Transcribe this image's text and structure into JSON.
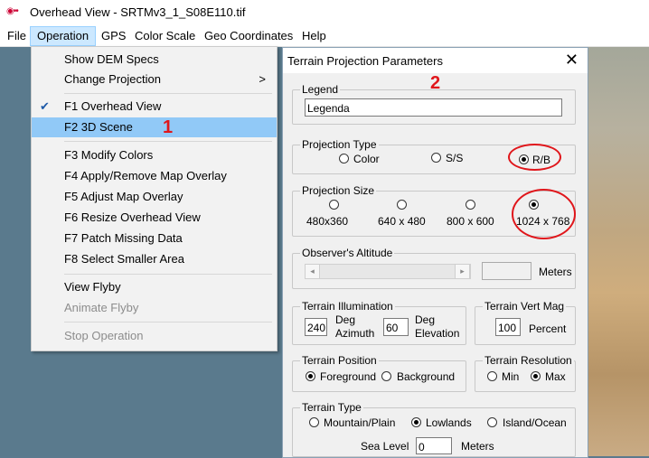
{
  "window": {
    "title": "Overhead View - SRTMv3_1_S08E110.tif",
    "icon": "app-icon"
  },
  "menubar": [
    "File",
    "Operation",
    "GPS",
    "Color Scale",
    "Geo Coordinates",
    "Help"
  ],
  "operation_menu": {
    "items": [
      {
        "label": "Show DEM Specs"
      },
      {
        "label": "Change Projection",
        "arrow": ">"
      },
      {
        "label": "F1  Overhead View",
        "checked": true
      },
      {
        "label": "F2  3D Scene",
        "highlighted": true
      },
      {
        "label": "F3  Modify Colors"
      },
      {
        "label": "F4  Apply/Remove Map Overlay"
      },
      {
        "label": "F5  Adjust Map Overlay"
      },
      {
        "label": "F6  Resize Overhead View"
      },
      {
        "label": "F7  Patch Missing Data"
      },
      {
        "label": "F8  Select Smaller Area"
      },
      {
        "label": "View Flyby"
      },
      {
        "label": "Animate Flyby",
        "disabled": true
      },
      {
        "label": "Stop Operation",
        "disabled": true
      }
    ],
    "checkmark": "✔"
  },
  "annotations": {
    "one": "1",
    "two": "2"
  },
  "dialog": {
    "title": "Terrain Projection Parameters",
    "close": "✕",
    "legend_group": {
      "label": "Legend",
      "value": "Legenda"
    },
    "projection_type": {
      "label": "Projection Type",
      "options": [
        "Color",
        "S/S",
        "R/B"
      ],
      "selected": "R/B"
    },
    "projection_size": {
      "label": "Projection Size",
      "options": [
        "480x360",
        "640 x 480",
        "800 x 600",
        "1024 x 768"
      ],
      "selected": "1024 x 768"
    },
    "observer": {
      "label": "Observer's Altitude",
      "units": "Meters",
      "left_arrow": "◂",
      "right_arrow": "▸"
    },
    "illumination": {
      "label": "Terrain Illumination",
      "azimuth_value": "240",
      "azimuth_unit_1": "Deg",
      "azimuth_unit_2": "Azimuth",
      "elevation_value": "60",
      "elevation_unit_1": "Deg",
      "elevation_unit_2": "Elevation"
    },
    "vert_mag": {
      "label": "Terrain Vert Mag",
      "value": "100",
      "unit": "Percent"
    },
    "position": {
      "label": "Terrain Position",
      "options": [
        "Foreground",
        "Background"
      ],
      "selected": "Foreground"
    },
    "resolution": {
      "label": "Terrain Resolution",
      "options": [
        "Min",
        "Max"
      ],
      "selected": "Max"
    },
    "terrain_type": {
      "label": "Terrain Type",
      "options": [
        "Mountain/Plain",
        "Lowlands",
        "Island/Ocean"
      ],
      "selected": "Lowlands",
      "sea_level_label": "Sea Level",
      "sea_level_value": "0",
      "sea_level_unit": "Meters"
    }
  }
}
